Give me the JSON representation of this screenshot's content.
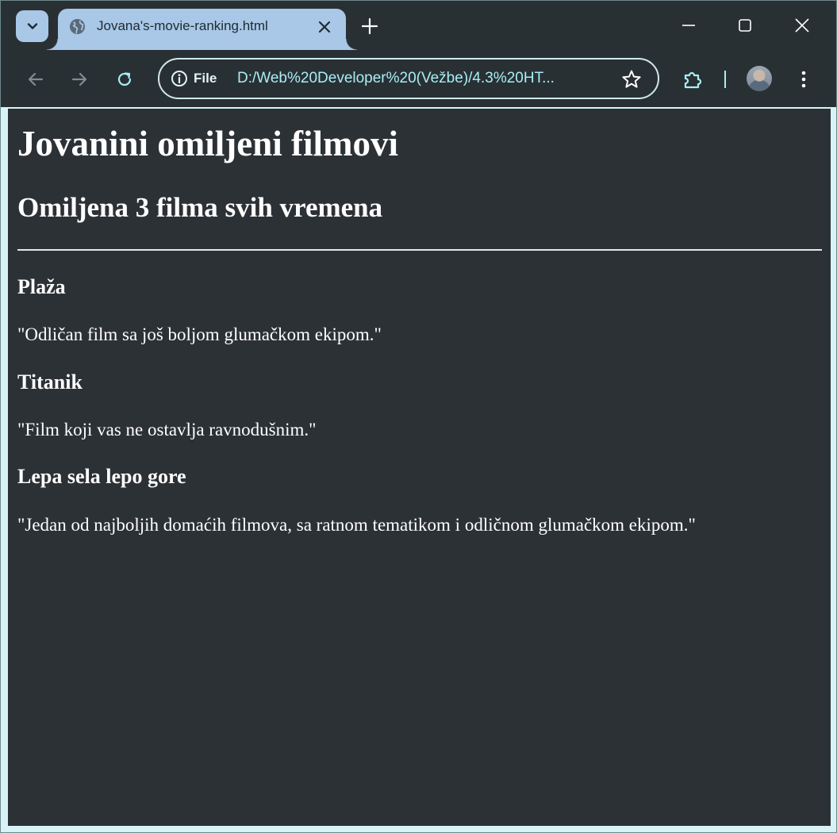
{
  "browser": {
    "tab_title": "Jovana's-movie-ranking.html",
    "address_chip": "File",
    "url": "D:/Web%20Developer%20(Vežbe)/4.3%20HT..."
  },
  "page": {
    "title": "Jovanini omiljeni filmovi",
    "subtitle": "Omiljena 3 filma svih vremena",
    "movies": [
      {
        "name": "Plaža",
        "review": "\"Odličan film sa još boljom glumačkom ekipom.\""
      },
      {
        "name": "Titanik",
        "review": "\"Film koji vas ne ostavlja ravnodušnim.\""
      },
      {
        "name": "Lepa sela lepo gore",
        "review": "\"Jedan od najboljih domaćih filmova, sa ratnom tematikom i odličnom glumačkom ekipom.\""
      }
    ]
  },
  "colors": {
    "tab_active": "#a9c7e6",
    "chrome_bg": "#293034",
    "page_bg": "#2c3136",
    "url_text": "#a8eef4"
  }
}
